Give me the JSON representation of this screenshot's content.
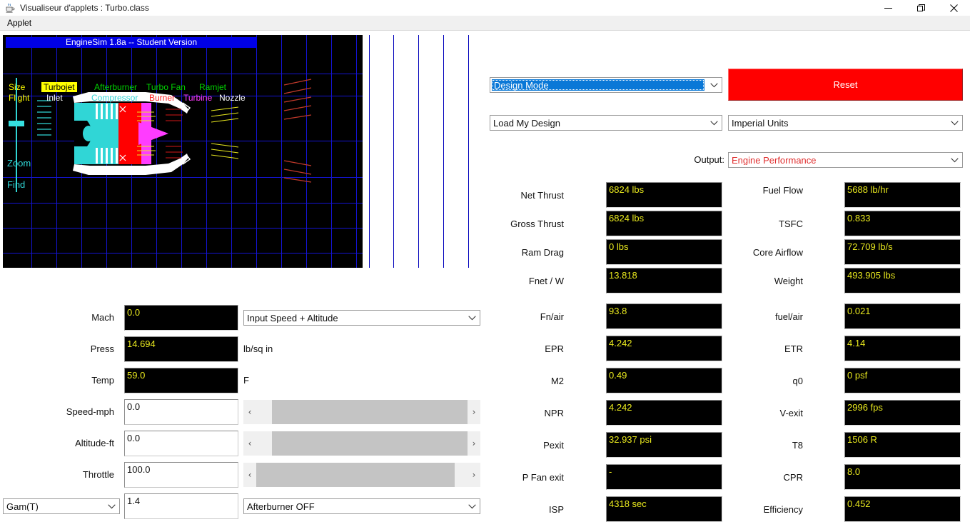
{
  "window": {
    "title": "Visualiseur d'applets : Turbo.class",
    "icon": "java-coffee-cup-icon",
    "buttons": {
      "minimize": "minimize-icon",
      "maximize": "restore-icon",
      "close": "close-icon"
    }
  },
  "menubar": {
    "items": [
      "Applet"
    ]
  },
  "sim": {
    "header": "EngineSim 1.8a  --  Student Version",
    "nav_row1": [
      {
        "label": "Size",
        "color": "#ffff00",
        "selected": false
      },
      {
        "label": "Turbojet",
        "color": "#000000",
        "selected": true
      },
      {
        "label": "Afterburner",
        "color": "#00d200",
        "selected": false
      },
      {
        "label": "Turbo Fan",
        "color": "#00d200",
        "selected": false
      },
      {
        "label": "Ramjet",
        "color": "#00d200",
        "selected": false
      }
    ],
    "nav_row2": [
      {
        "label": "Flight",
        "color": "#ffff00"
      },
      {
        "label": "Inlet",
        "color": "#ffffff"
      },
      {
        "label": "Compressor",
        "color": "#30d6d6"
      },
      {
        "label": "Burner",
        "color": "#ff2020"
      },
      {
        "label": "Turbine",
        "color": "#ff3cff"
      },
      {
        "label": "Nozzle",
        "color": "#ffffff"
      }
    ],
    "zoom_label": "Zoom",
    "find_label": "Find",
    "highlight_bg": "#ffff00",
    "grid_color": "#1414d2",
    "bg_color": "#000000"
  },
  "inputs": {
    "rows": [
      {
        "label": "Mach",
        "value": "0.0",
        "unit": "",
        "style": "black"
      },
      {
        "label": "Press",
        "value": "14.694",
        "unit": "lb/sq in",
        "style": "black"
      },
      {
        "label": "Temp",
        "value": "59.0",
        "unit": "F",
        "style": "black"
      },
      {
        "label": "Speed-mph",
        "value": "0.0",
        "unit": "",
        "style": "white"
      },
      {
        "label": "Altitude-ft",
        "value": "0.0",
        "unit": "",
        "style": "white"
      },
      {
        "label": "Throttle",
        "value": "100.0",
        "unit": "",
        "style": "white"
      }
    ],
    "gam_select": "Gam(T)",
    "gam_value": "1.4",
    "speed_mode_select": "Input Speed + Altitude",
    "afterburner_select": "Afterburner OFF",
    "arrows": {
      "left": "‹",
      "right": "›"
    }
  },
  "controls": {
    "mode_select": "Design Mode",
    "reset_label": "Reset",
    "design_select": "Load My Design",
    "units_select": "Imperial Units",
    "output_word": "Output:",
    "output_select": "Engine Performance",
    "reset_color": "#ff0000",
    "select_highlight": "#0a78d7",
    "output_text_color": "#e03030"
  },
  "outputs": {
    "left_column": [
      {
        "label": "Net Thrust",
        "value": "6824 lbs"
      },
      {
        "label": "Gross Thrust",
        "value": "6824 lbs"
      },
      {
        "label": "Ram Drag",
        "value": "0 lbs"
      },
      {
        "label": "Fnet / W",
        "value": "13.818"
      },
      {
        "label": "Fn/air",
        "value": "93.8"
      },
      {
        "label": "EPR",
        "value": "4.242"
      },
      {
        "label": "M2",
        "value": "0.49"
      },
      {
        "label": "NPR",
        "value": "4.242"
      },
      {
        "label": "Pexit",
        "value": "32.937 psi"
      },
      {
        "label": "P Fan exit",
        "value": "-"
      },
      {
        "label": "ISP",
        "value": "4318 sec"
      }
    ],
    "right_column": [
      {
        "label": "Fuel Flow",
        "value": "5688 lb/hr"
      },
      {
        "label": "TSFC",
        "value": "0.833"
      },
      {
        "label": "Core Airflow",
        "value": "72.709 lb/s"
      },
      {
        "label": "Weight",
        "value": "493.905 lbs"
      },
      {
        "label": "fuel/air",
        "value": "0.021"
      },
      {
        "label": "ETR",
        "value": "4.14"
      },
      {
        "label": "q0",
        "value": "0 psf"
      },
      {
        "label": "V-exit",
        "value": "2996 fps"
      },
      {
        "label": "T8",
        "value": "1506 R"
      },
      {
        "label": "CPR",
        "value": "8.0"
      },
      {
        "label": "Efficiency",
        "value": "0.452"
      }
    ],
    "value_text_color": "#e8e81e",
    "value_bg_color": "#000000"
  }
}
